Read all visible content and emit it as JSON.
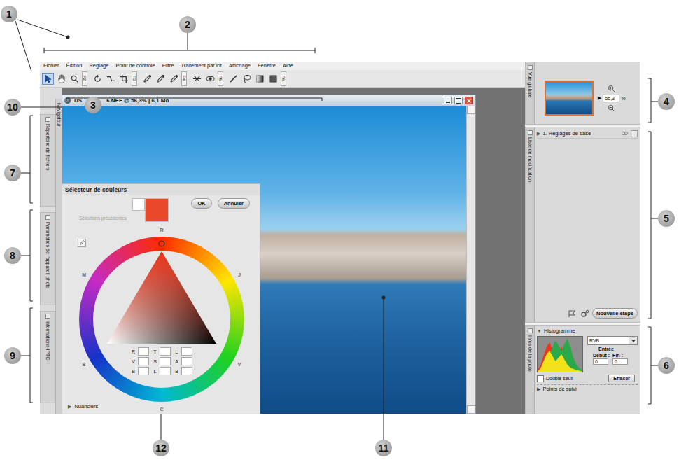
{
  "callouts": [
    "1",
    "2",
    "3",
    "4",
    "5",
    "6",
    "7",
    "8",
    "9",
    "10",
    "11",
    "12"
  ],
  "menu": [
    "Fichier",
    "Édition",
    "Réglage",
    "Point de contrôle",
    "Filtre",
    "Traitement par lot",
    "Affichage",
    "Fenêtre",
    "Aide"
  ],
  "toolbar": [
    {
      "key": "F2",
      "tools": [
        {
          "kind": "arrow",
          "selected": true
        },
        {
          "kind": "hand",
          "selected": false
        },
        {
          "kind": "zoom",
          "selected": false
        }
      ]
    },
    {
      "key": "F3",
      "tools": [
        {
          "kind": "rotate",
          "selected": false
        },
        {
          "kind": "straighten",
          "selected": false
        },
        {
          "kind": "crop",
          "selected": false
        }
      ]
    },
    {
      "key": "F4",
      "tools": [
        {
          "kind": "dropper",
          "selected": false
        },
        {
          "kind": "dropper",
          "selected": false
        },
        {
          "kind": "dropper",
          "selected": false
        }
      ]
    },
    {
      "key": "F5",
      "tools": [
        {
          "kind": "burst",
          "selected": false
        },
        {
          "kind": "eye",
          "selected": false
        }
      ]
    },
    {
      "key": "F6",
      "tools": [
        {
          "kind": "line",
          "selected": false
        },
        {
          "kind": "lasso",
          "selected": false
        },
        {
          "kind": "gradient",
          "selected": false
        },
        {
          "kind": "fill",
          "selected": false
        }
      ]
    }
  ],
  "left_panel": {
    "tabs": [
      {
        "label": "Répertoire de fichiers"
      },
      {
        "label": "Paramètres de l'appareil photo"
      },
      {
        "label": "Informations IPTC"
      }
    ],
    "navigator": "Navigateur"
  },
  "image_window": {
    "title_start": "DS",
    "title_end": "6.NEF @ 56,3% | 6,1 Mo"
  },
  "right_panel": {
    "overview": {
      "label": "Vue globale",
      "zoom": "56,3",
      "unit": "%",
      "pointer": "▶"
    },
    "edit_list": {
      "label": "Liste de modification",
      "steps": [
        {
          "label": "1. Réglages de base",
          "glyph": "▶",
          "expanded": false
        }
      ],
      "new_step": "Nouvelle étape"
    },
    "photo_info": {
      "label": "Infos de la photo",
      "histogram": {
        "title": "Histogramme",
        "glyph": "▼",
        "expanded": true,
        "channel": "RVB",
        "input_label": "Entrée",
        "start_label": "Début :",
        "end_label": "Fin :",
        "start": "0",
        "end": "0",
        "double_threshold": {
          "label": "Double seuil",
          "checked": false
        },
        "clear": "Effacer",
        "series": [
          {
            "name": "R",
            "color": "#e8361f",
            "values": [
              5,
              20,
              45,
              70,
              85,
              62,
              40,
              55,
              72,
              50,
              30,
              20,
              15,
              10,
              5,
              2
            ]
          },
          {
            "name": "V",
            "color": "#2aa84a",
            "values": [
              0,
              5,
              15,
              30,
              50,
              70,
              90,
              75,
              60,
              80,
              95,
              70,
              40,
              20,
              10,
              5
            ]
          },
          {
            "name": "J",
            "color": "#f2e21a",
            "values": [
              2,
              10,
              30,
              50,
              60,
              45,
              30,
              40,
              50,
              35,
              20,
              12,
              8,
              5,
              3,
              1
            ]
          }
        ]
      },
      "tracking": {
        "label": "Points de suivi",
        "glyph": "▶",
        "expanded": false
      }
    }
  },
  "color_picker": {
    "title": "Sélecteur de couleurs",
    "ok": "OK",
    "cancel": "Annuler",
    "previous_label": "Sélections précédentes",
    "swatches": [
      {
        "color": "#ffffff"
      },
      {
        "color": "#e8492b"
      }
    ],
    "hues": [
      "R",
      "J",
      "V",
      "C",
      "B",
      "M"
    ],
    "marker_angle": 0,
    "fields": [
      [
        "R",
        "T",
        "L"
      ],
      [
        "V",
        "S",
        "A"
      ],
      [
        "B",
        "L",
        "B"
      ]
    ],
    "swatch_books": {
      "label": "Nuanciers",
      "glyph": "▶",
      "expanded": false
    }
  }
}
